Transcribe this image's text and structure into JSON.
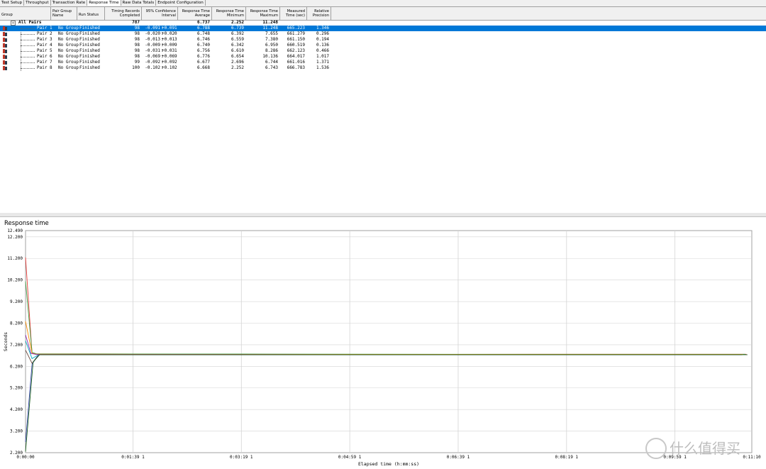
{
  "tabs": [
    "Test Setup",
    "Throughput",
    "Transaction Rate",
    "Response Time",
    "Raw Data Totals",
    "Endpoint Configuration"
  ],
  "active_tab": "Response Time",
  "columns": {
    "group": "Group",
    "pair_group_name": "Pair Group\nName",
    "run_status": "Run Status",
    "timing_records": "Timing Records\nCompleted",
    "confidence": "95% Confidence\nInterval",
    "avg": "Response Time\nAverage",
    "min": "Response Time\nMinimum",
    "max": "Response Time\nMaximum",
    "measured": "Measured\nTime (sec)",
    "precision": "Relative\nPrecision"
  },
  "summary": {
    "label": "All Pairs",
    "records": "787",
    "avg": "6.737",
    "min": "2.252",
    "max": "11.248"
  },
  "rows": [
    {
      "pair": "Pair 1",
      "group": "No Group",
      "status": "Finished",
      "records": "98",
      "ci_lo": "-0.091",
      "ci_hi": "+0.091",
      "avg": "6.788",
      "min": "6.739",
      "max": "11.248",
      "measured": "665.223",
      "precision": "1.346",
      "selected": true
    },
    {
      "pair": "Pair 2",
      "group": "No Group",
      "status": "Finished",
      "records": "98",
      "ci_lo": "-0.020",
      "ci_hi": "+0.020",
      "avg": "6.748",
      "min": "6.392",
      "max": "7.655",
      "measured": "661.279",
      "precision": "0.296"
    },
    {
      "pair": "Pair 3",
      "group": "No Group",
      "status": "Finished",
      "records": "98",
      "ci_lo": "-0.013",
      "ci_hi": "+0.013",
      "avg": "6.746",
      "min": "6.559",
      "max": "7.380",
      "measured": "661.150",
      "precision": "0.194"
    },
    {
      "pair": "Pair 4",
      "group": "No Group",
      "status": "Finished",
      "records": "98",
      "ci_lo": "-0.009",
      "ci_hi": "+0.009",
      "avg": "6.740",
      "min": "6.342",
      "max": "6.950",
      "measured": "660.519",
      "precision": "0.136"
    },
    {
      "pair": "Pair 5",
      "group": "No Group",
      "status": "Finished",
      "records": "98",
      "ci_lo": "-0.031",
      "ci_hi": "+0.031",
      "avg": "6.756",
      "min": "6.610",
      "max": "8.286",
      "measured": "662.123",
      "precision": "0.466"
    },
    {
      "pair": "Pair 6",
      "group": "No Group",
      "status": "Finished",
      "records": "98",
      "ci_lo": "-0.069",
      "ci_hi": "+0.069",
      "avg": "6.776",
      "min": "6.654",
      "max": "10.136",
      "measured": "664.017",
      "precision": "1.017"
    },
    {
      "pair": "Pair 7",
      "group": "No Group",
      "status": "Finished",
      "records": "99",
      "ci_lo": "-0.092",
      "ci_hi": "+0.092",
      "avg": "6.677",
      "min": "2.696",
      "max": "6.744",
      "measured": "661.016",
      "precision": "1.371"
    },
    {
      "pair": "Pair 8",
      "group": "No Group",
      "status": "Finished",
      "records": "100",
      "ci_lo": "-0.102",
      "ci_hi": "+0.102",
      "avg": "6.668",
      "min": "2.252",
      "max": "6.743",
      "measured": "666.783",
      "precision": "1.536"
    }
  ],
  "colors": {
    "selection": "#0078d7",
    "grid": "#d4d4d4"
  },
  "chart_data": {
    "type": "line",
    "title": "Response time",
    "xlabel": "Elapsed time (h:mm:ss)",
    "ylabel": "Seconds",
    "ylim": [
      2.2,
      12.49
    ],
    "xlim": [
      0,
      670
    ],
    "y_ticks": [
      "12.490",
      "12.200",
      "11.200",
      "10.200",
      "9.200",
      "8.200",
      "7.200",
      "6.200",
      "5.200",
      "4.200",
      "3.200",
      "2.200"
    ],
    "x_ticks": [
      "0:00:00",
      "0:01:39 1",
      "0:03:19 1",
      "0:04:59 1",
      "0:06:39 1",
      "0:08:19 1",
      "0:09:59 1",
      "0:11:10"
    ],
    "x_tick_seconds": [
      0,
      99.1,
      199.1,
      299.1,
      399.1,
      499.1,
      599.1,
      670
    ],
    "series": [
      {
        "color": "#e53935",
        "points": [
          [
            0,
            11.248
          ],
          [
            6,
            6.8
          ],
          [
            10,
            6.78
          ],
          [
            100,
            6.77
          ],
          [
            300,
            6.75
          ],
          [
            500,
            6.76
          ],
          [
            665,
            6.76
          ]
        ]
      },
      {
        "color": "#43a047",
        "points": [
          [
            0,
            10.136
          ],
          [
            6,
            6.85
          ],
          [
            10,
            6.78
          ],
          [
            200,
            6.77
          ],
          [
            400,
            6.76
          ],
          [
            664,
            6.76
          ]
        ]
      },
      {
        "color": "#fb8c00",
        "points": [
          [
            0,
            8.286
          ],
          [
            6,
            6.8
          ],
          [
            10,
            6.76
          ],
          [
            300,
            6.75
          ],
          [
            662,
            6.75
          ]
        ]
      },
      {
        "color": "#8e24aa",
        "points": [
          [
            0,
            7.655
          ],
          [
            5,
            6.8
          ],
          [
            10,
            6.75
          ],
          [
            300,
            6.74
          ],
          [
            661,
            6.74
          ]
        ]
      },
      {
        "color": "#00acc1",
        "points": [
          [
            0,
            7.38
          ],
          [
            6,
            6.56
          ],
          [
            12,
            6.74
          ],
          [
            300,
            6.74
          ],
          [
            661,
            6.74
          ]
        ]
      },
      {
        "color": "#6d4c41",
        "points": [
          [
            0,
            6.95
          ],
          [
            6,
            6.34
          ],
          [
            12,
            6.74
          ],
          [
            300,
            6.74
          ],
          [
            660,
            6.74
          ]
        ]
      },
      {
        "color": "#3949ab",
        "points": [
          [
            0,
            2.696
          ],
          [
            6,
            6.3
          ],
          [
            12,
            6.74
          ],
          [
            300,
            6.74
          ],
          [
            661,
            6.74
          ]
        ]
      },
      {
        "color": "#1b5e20",
        "points": [
          [
            0,
            2.252
          ],
          [
            7,
            6.4
          ],
          [
            13,
            6.74
          ],
          [
            300,
            6.74
          ],
          [
            666,
            6.74
          ]
        ]
      }
    ]
  },
  "watermark": "什么值得买"
}
